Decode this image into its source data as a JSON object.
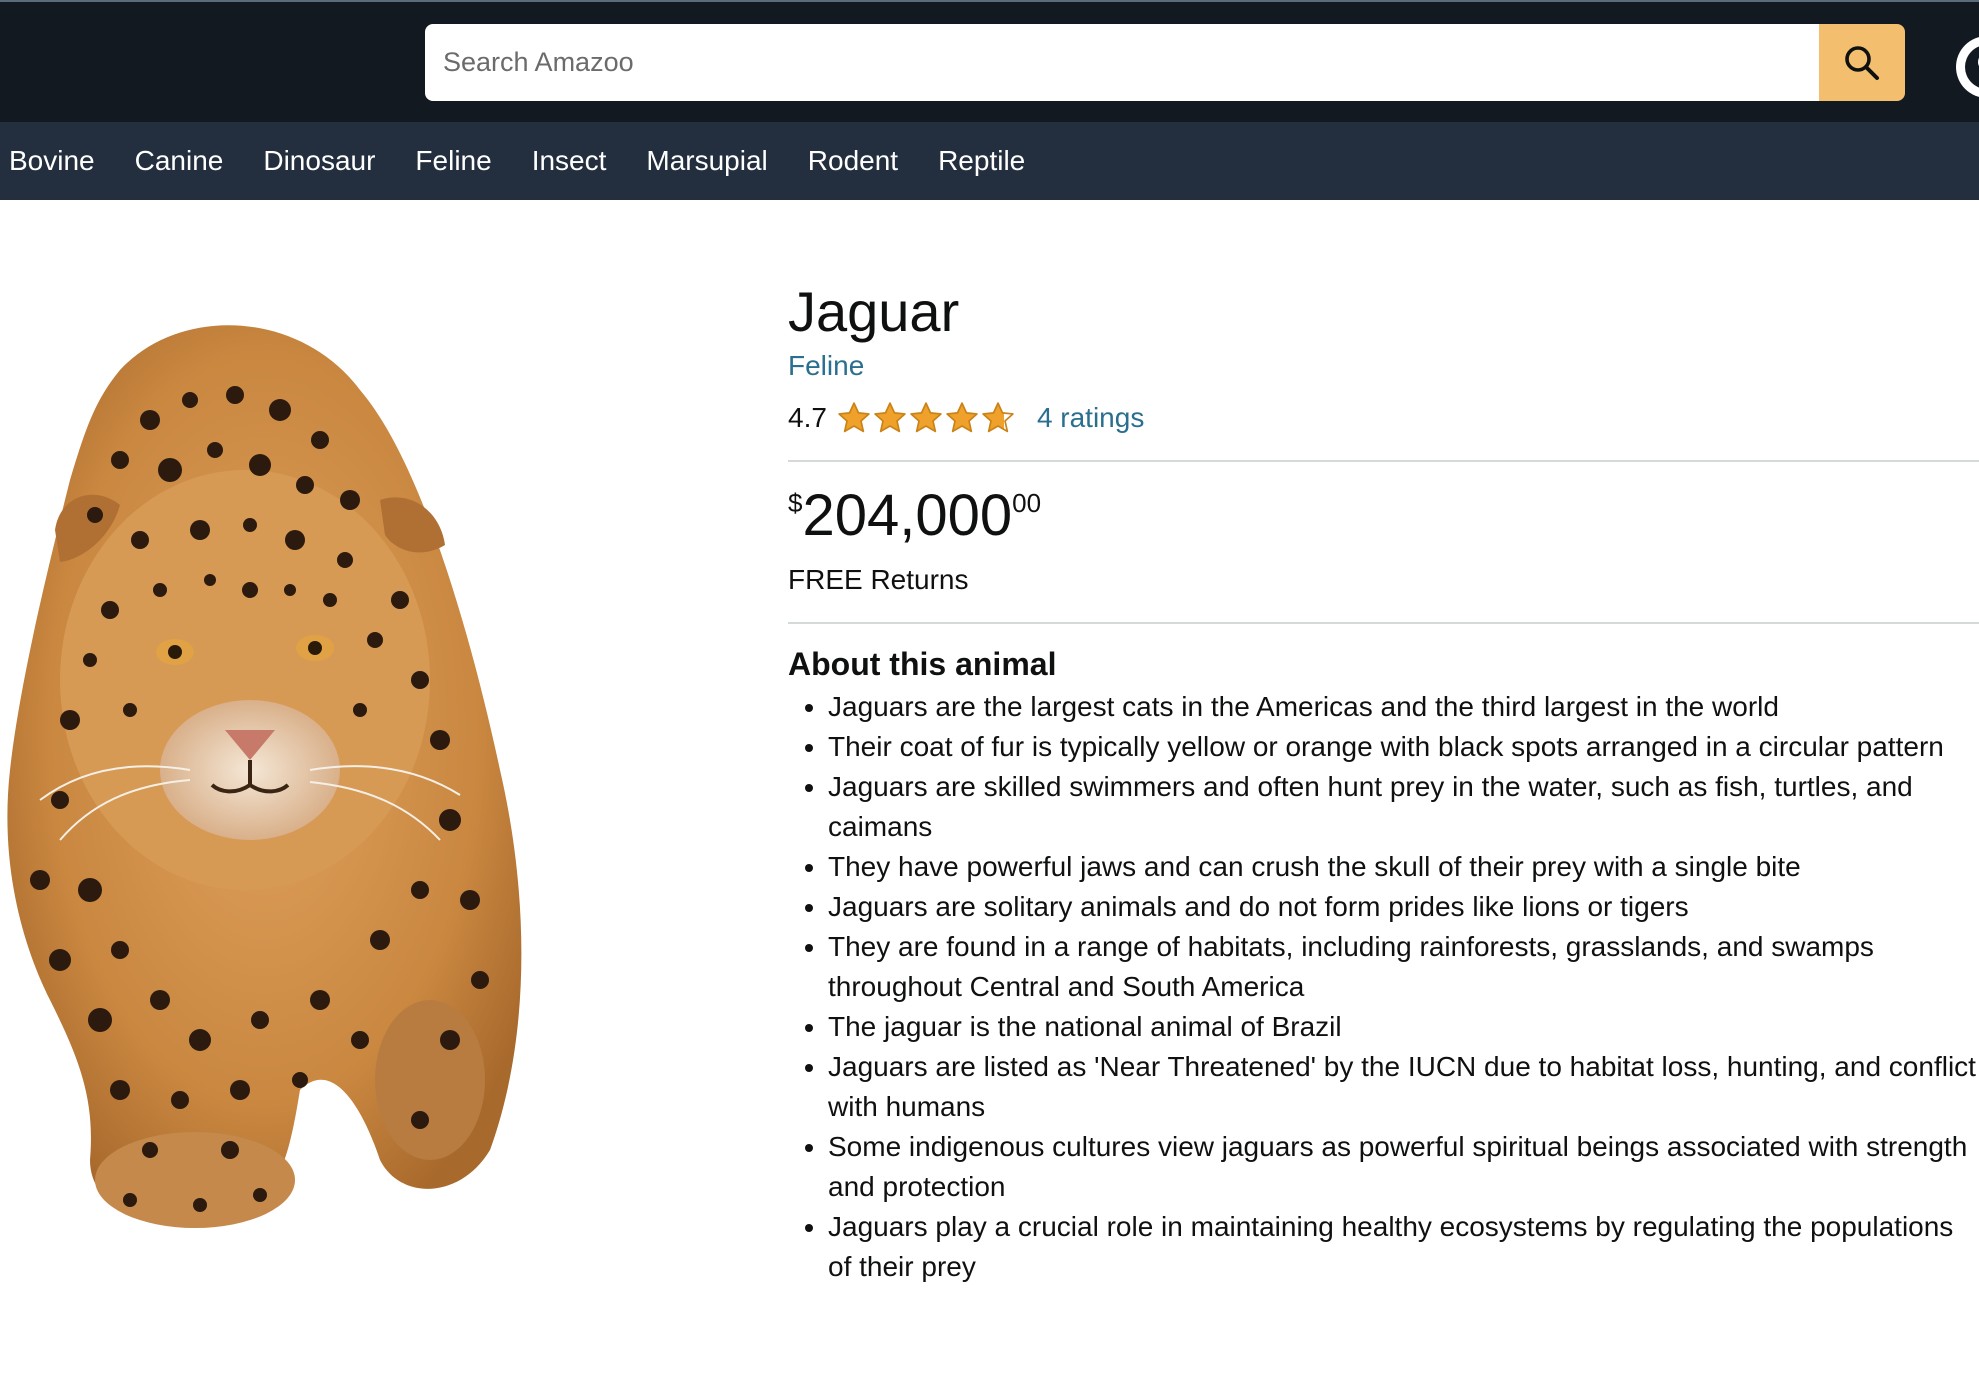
{
  "search": {
    "placeholder": "Search Amazoo",
    "value": ""
  },
  "header": {
    "search_button_icon": "search-icon",
    "account_icon": "account-icon"
  },
  "nav": {
    "items": [
      {
        "label": "Bovine"
      },
      {
        "label": "Canine"
      },
      {
        "label": "Dinosaur"
      },
      {
        "label": "Feline"
      },
      {
        "label": "Insect"
      },
      {
        "label": "Marsupial"
      },
      {
        "label": "Rodent"
      },
      {
        "label": "Reptile"
      }
    ]
  },
  "product": {
    "title": "Jaguar",
    "category": "Feline",
    "rating_value": "4.7",
    "rating_stars": 4.7,
    "ratings_count": "4 ratings",
    "price_symbol": "$",
    "price_whole": "204,000",
    "price_fraction": "00",
    "returns": "FREE Returns",
    "about_heading": "About this animal",
    "about": [
      "Jaguars are the largest cats in the Americas and the third largest in the world",
      "Their coat of fur is typically yellow or orange with black spots arranged in a circular pattern",
      "Jaguars are skilled swimmers and often hunt prey in the water, such as fish, turtles, and caimans",
      "They have powerful jaws and can crush the skull of their prey with a single bite",
      "Jaguars are solitary animals and do not form prides like lions or tigers",
      "They are found in a range of habitats, including rainforests, grasslands, and swamps throughout Central and South America",
      "The jaguar is the national animal of Brazil",
      "Jaguars are listed as 'Near Threatened' by the IUCN due to habitat loss, hunting, and conflict with humans",
      "Some indigenous cultures view jaguars as powerful spiritual beings associated with strength and protection",
      "Jaguars play a crucial role in maintaining healthy ecosystems by regulating the populations of their prey"
    ]
  },
  "colors": {
    "header_bg": "#131921",
    "nav_bg": "#232f3e",
    "search_button": "#f3bf6f",
    "link": "#2a6f8f",
    "star": "#f0a12b"
  }
}
